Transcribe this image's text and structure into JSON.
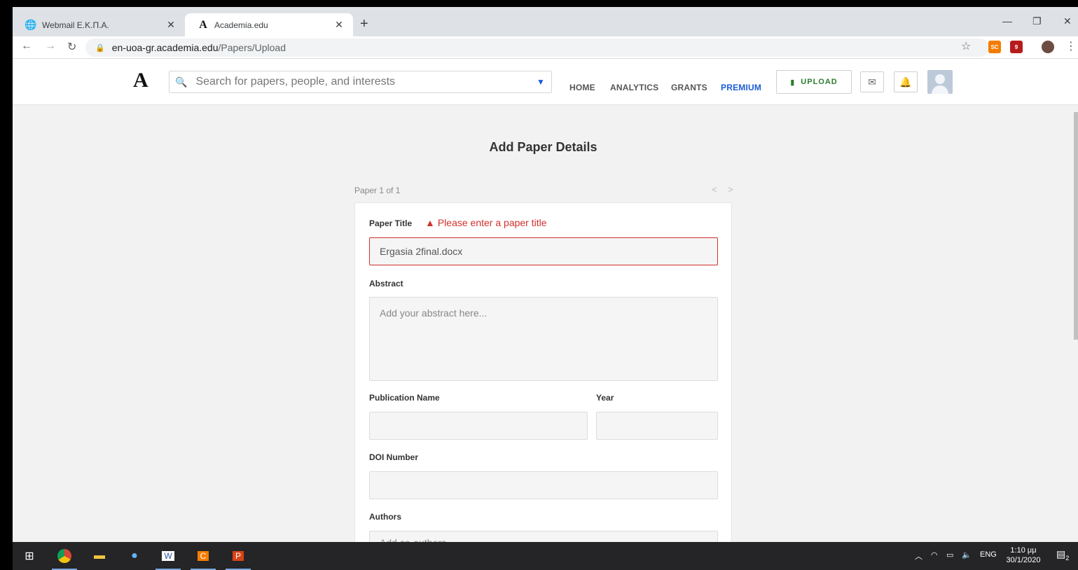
{
  "browser": {
    "tabs": [
      {
        "title": "Webmail Ε.Κ.Π.Α.",
        "icon": "globe-icon",
        "glyph": "🌐"
      },
      {
        "title": "Academia.edu",
        "icon": "academia-logo-icon",
        "glyph": "A"
      }
    ],
    "close_glyph": "✕",
    "new_tab_glyph": "+",
    "url_host": "en-uoa-gr.academia.edu",
    "url_path": "/Papers/Upload",
    "extensions": [
      {
        "name": "sc-extension-icon",
        "label": "SC",
        "color": "#f57c00"
      },
      {
        "name": "ublock-extension-icon",
        "label": "9",
        "color": "#b71c1c"
      }
    ]
  },
  "header": {
    "logo": "A",
    "search_placeholder": "Search for papers, people, and interests",
    "nav": {
      "home": "HOME",
      "analytics": "ANALYTICS",
      "grants": "GRANTS",
      "premium": "PREMIUM"
    },
    "upload_label": "UPLOAD"
  },
  "page": {
    "title": "Add Paper Details",
    "pager": "Paper 1 of 1",
    "pager_arrows": "< >"
  },
  "form": {
    "paper_title_label": "Paper Title",
    "paper_title_error": "Please enter a paper title",
    "paper_title_value": "Ergasia 2final.docx",
    "abstract_label": "Abstract",
    "abstract_placeholder": "Add your abstract here...",
    "publication_name_label": "Publication Name",
    "year_label": "Year",
    "doi_label": "DOI Number",
    "authors_label": "Authors",
    "authors_placeholder": "Add co-authors"
  },
  "taskbar": {
    "language": "ENG",
    "time": "1:10 μμ",
    "date": "30/1/2020",
    "notifications": "2"
  }
}
